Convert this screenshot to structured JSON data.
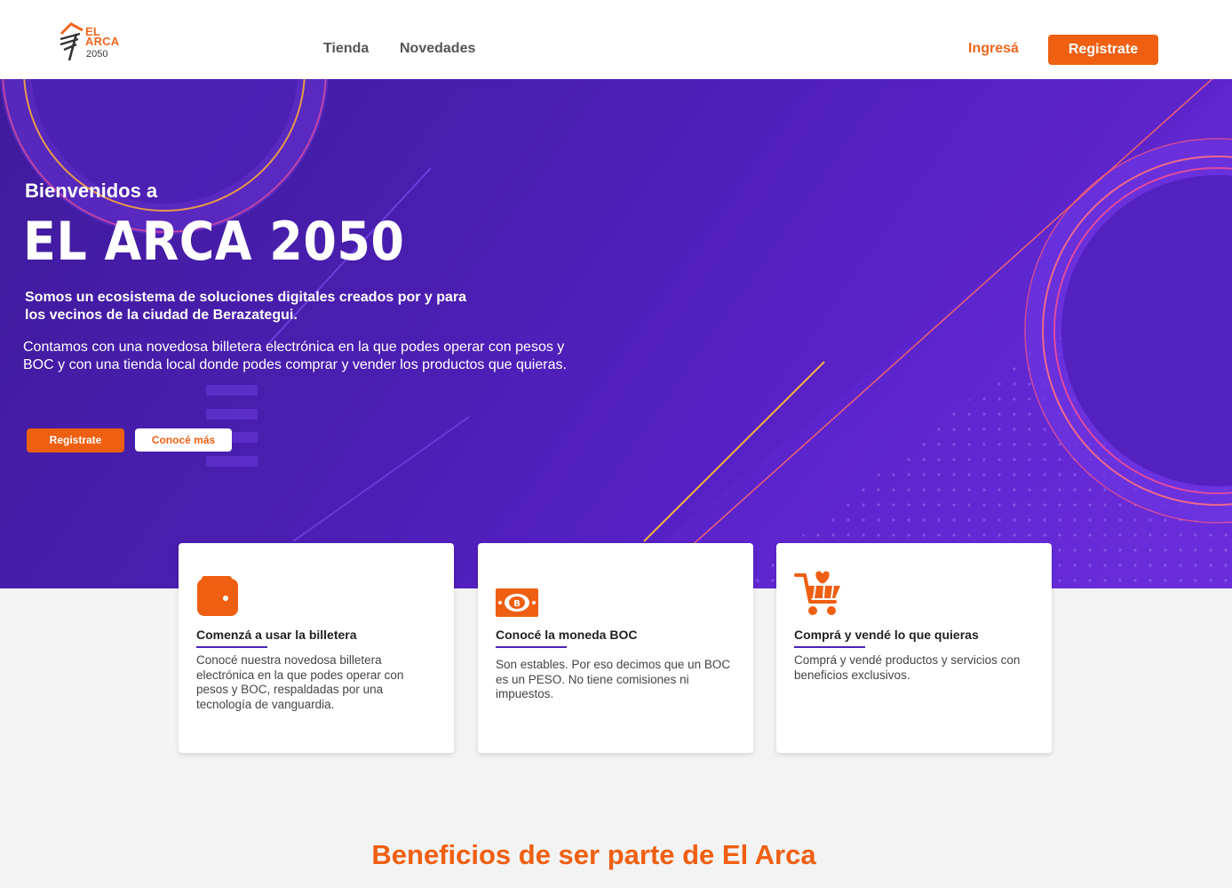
{
  "header": {
    "logo": {
      "line1": "EL",
      "line2": "ARCA",
      "year": "2050"
    },
    "nav": [
      {
        "label": "Tienda"
      },
      {
        "label": "Novedades"
      }
    ],
    "login_label": "Ingresá",
    "register_label": "Registrate"
  },
  "hero": {
    "welcome": "Bienvenidos a",
    "title": "EL ARCA 2050",
    "subtitle": "Somos un ecosistema de soluciones digitales creados por y para los vecinos de la ciudad de Berazategui.",
    "description": "Contamos con una novedosa billetera electrónica en la que podes operar con pesos y BOC y con una tienda local donde podes comprar y vender los productos que quieras.",
    "register_button": "Registrate",
    "more_button": "Conocé más"
  },
  "cards": [
    {
      "icon": "wallet-icon",
      "title": "Comenzá a usar la billetera",
      "text": "Conocé nuestra novedosa billetera electrónica en la que podes operar con pesos y BOC, respaldadas por una tecnología de vanguardia."
    },
    {
      "icon": "bill-icon",
      "title": "Conocé la moneda BOC",
      "text": "Son estables. Por eso decimos que un BOC es un PESO. No tiene comisiones ni impuestos."
    },
    {
      "icon": "cart-heart-icon",
      "title": "Comprá y vendé lo que quieras",
      "text": "Comprá y vendé productos y servicios con beneficios exclusivos."
    }
  ],
  "benefits_title": "Beneficios de ser parte de El Arca",
  "colors": {
    "accent": "#ef5f12",
    "hero_purple": "#4a1eb0",
    "underline": "#4a22b6"
  }
}
